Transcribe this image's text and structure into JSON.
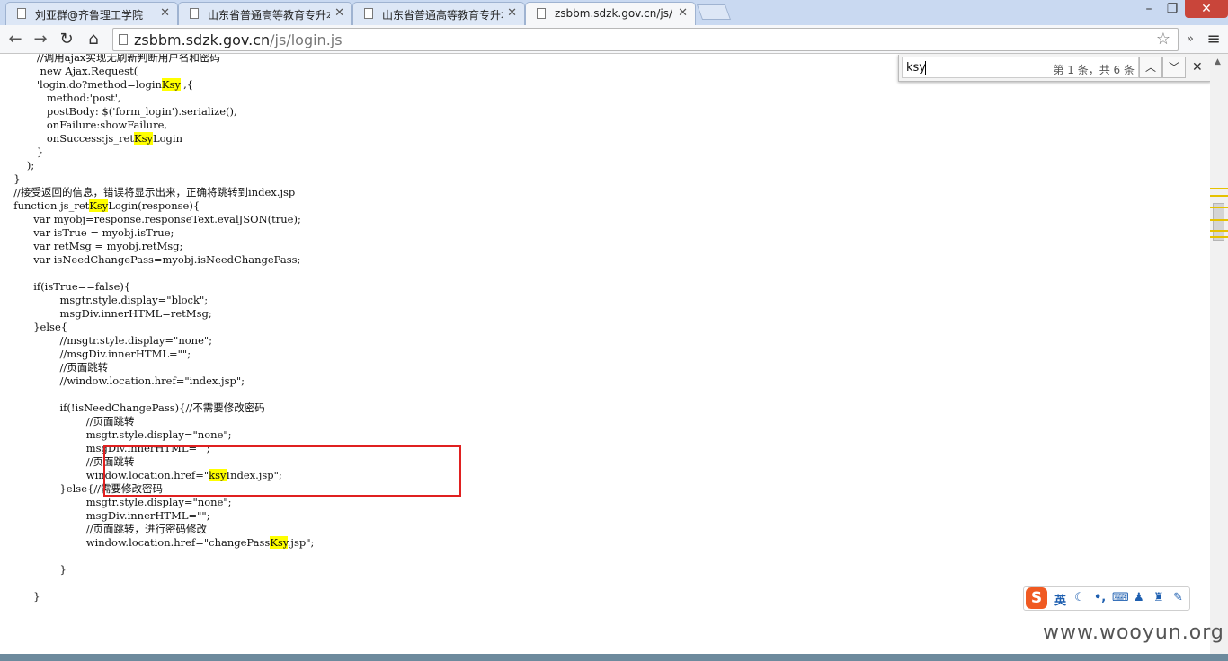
{
  "tabs": [
    {
      "label": "刘亚群@齐鲁理工学院"
    },
    {
      "label": "山东省普通高等教育专升本"
    },
    {
      "label": "山东省普通高等教育专升本"
    },
    {
      "label": "zsbbm.sdzk.gov.cn/js/lo"
    }
  ],
  "address": {
    "host": "zsbbm.sdzk.gov.cn",
    "path": "/js/login.js"
  },
  "find": {
    "query": "ksy",
    "count": "第 1 条，共 6 条"
  },
  "ime": {
    "lang": "英"
  },
  "watermark": "www.wooyun.org",
  "code_lines": [
    "         //调用ajax实现无刷新判断用户名和密码",
    "          new Ajax.Request(",
    "         'login.do?method=loginKsy',{",
    "            method:'post',",
    "            postBody: $('form_login').serialize(),",
    "            onFailure:showFailure,",
    "            onSuccess:js_retKsyLogin",
    "         }",
    "      );",
    "  }",
    "  //接受返回的信息，错误将显示出来，正确将跳转到index.jsp",
    "  function js_retKsyLogin(response){",
    "        var myobj=response.responseText.evalJSON(true);",
    "        var isTrue = myobj.isTrue;",
    "        var retMsg = myobj.retMsg;",
    "        var isNeedChangePass=myobj.isNeedChangePass;",
    "",
    "        if(isTrue==false){",
    "                msgtr.style.display=\"block\";",
    "                msgDiv.innerHTML=retMsg;",
    "        }else{",
    "                //msgtr.style.display=\"none\";",
    "                //msgDiv.innerHTML=\"\";",
    "                //页面跳转",
    "                //window.location.href=\"index.jsp\";",
    "",
    "                if(!isNeedChangePass){//不需要修改密码",
    "                        //页面跳转",
    "                        msgtr.style.display=\"none\";",
    "                        msgDiv.innerHTML=\"\";",
    "                        //页面跳转",
    "                        window.location.href=\"ksyIndex.jsp\";",
    "                }else{//需要修改密码",
    "                        msgtr.style.display=\"none\";",
    "                        msgDiv.innerHTML=\"\";",
    "                        //页面跳转，进行密码修改",
    "                        window.location.href=\"changePassKsy.jsp\";",
    "",
    "                }",
    "",
    "        }"
  ]
}
